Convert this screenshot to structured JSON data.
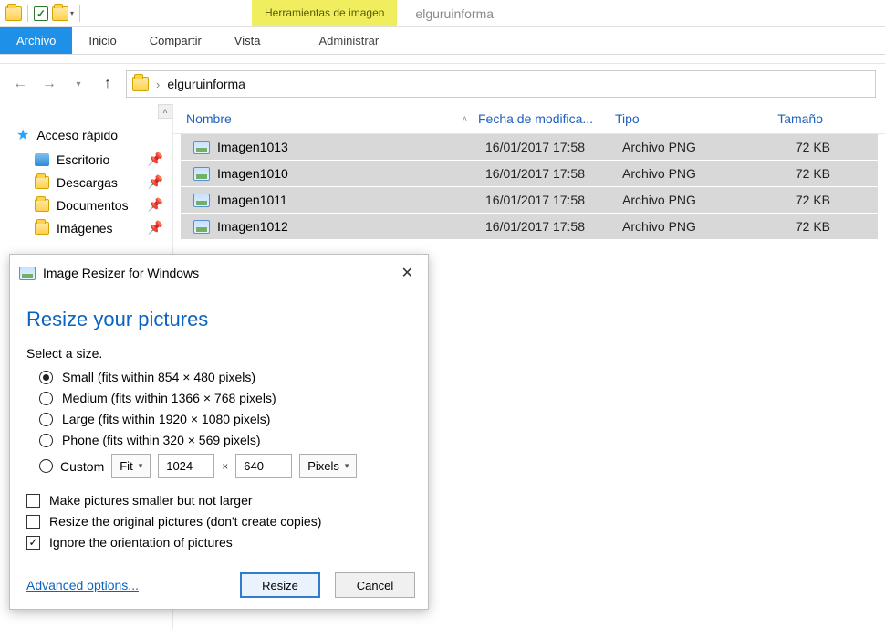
{
  "window": {
    "context_tab": "Herramientas de imagen",
    "title": "elguruinforma"
  },
  "ribbon": {
    "file": "Archivo",
    "home": "Inicio",
    "share": "Compartir",
    "view": "Vista",
    "manage": "Administrar"
  },
  "address": {
    "crumb": "elguruinforma"
  },
  "sidebar": {
    "quick_access": "Acceso rápido",
    "items": [
      {
        "label": "Escritorio"
      },
      {
        "label": "Descargas"
      },
      {
        "label": "Documentos"
      },
      {
        "label": "Imágenes"
      }
    ]
  },
  "columns": {
    "name": "Nombre",
    "date": "Fecha de modifica...",
    "type": "Tipo",
    "size": "Tamaño"
  },
  "rows": [
    {
      "name": "Imagen1013",
      "date": "16/01/2017 17:58",
      "type": "Archivo PNG",
      "size": "72 KB"
    },
    {
      "name": "Imagen1010",
      "date": "16/01/2017 17:58",
      "type": "Archivo PNG",
      "size": "72 KB"
    },
    {
      "name": "Imagen1011",
      "date": "16/01/2017 17:58",
      "type": "Archivo PNG",
      "size": "72 KB"
    },
    {
      "name": "Imagen1012",
      "date": "16/01/2017 17:58",
      "type": "Archivo PNG",
      "size": "72 KB"
    }
  ],
  "dialog": {
    "title": "Image Resizer for Windows",
    "heading": "Resize your pictures",
    "select_label": "Select a size.",
    "options": {
      "small": "Small (fits within 854 × 480 pixels)",
      "medium": "Medium (fits within 1366 × 768 pixels)",
      "large": "Large (fits within 1920 × 1080 pixels)",
      "phone": "Phone (fits within 320 × 569 pixels)",
      "custom_label": "Custom",
      "fit_label": "Fit",
      "width": "1024",
      "times": "×",
      "height": "640",
      "unit": "Pixels"
    },
    "checks": {
      "only_smaller": "Make pictures smaller but not larger",
      "resize_original": "Resize the original pictures (don't create copies)",
      "ignore_orientation": "Ignore the orientation of pictures"
    },
    "advanced": "Advanced options...",
    "resize_btn": "Resize",
    "cancel_btn": "Cancel"
  }
}
